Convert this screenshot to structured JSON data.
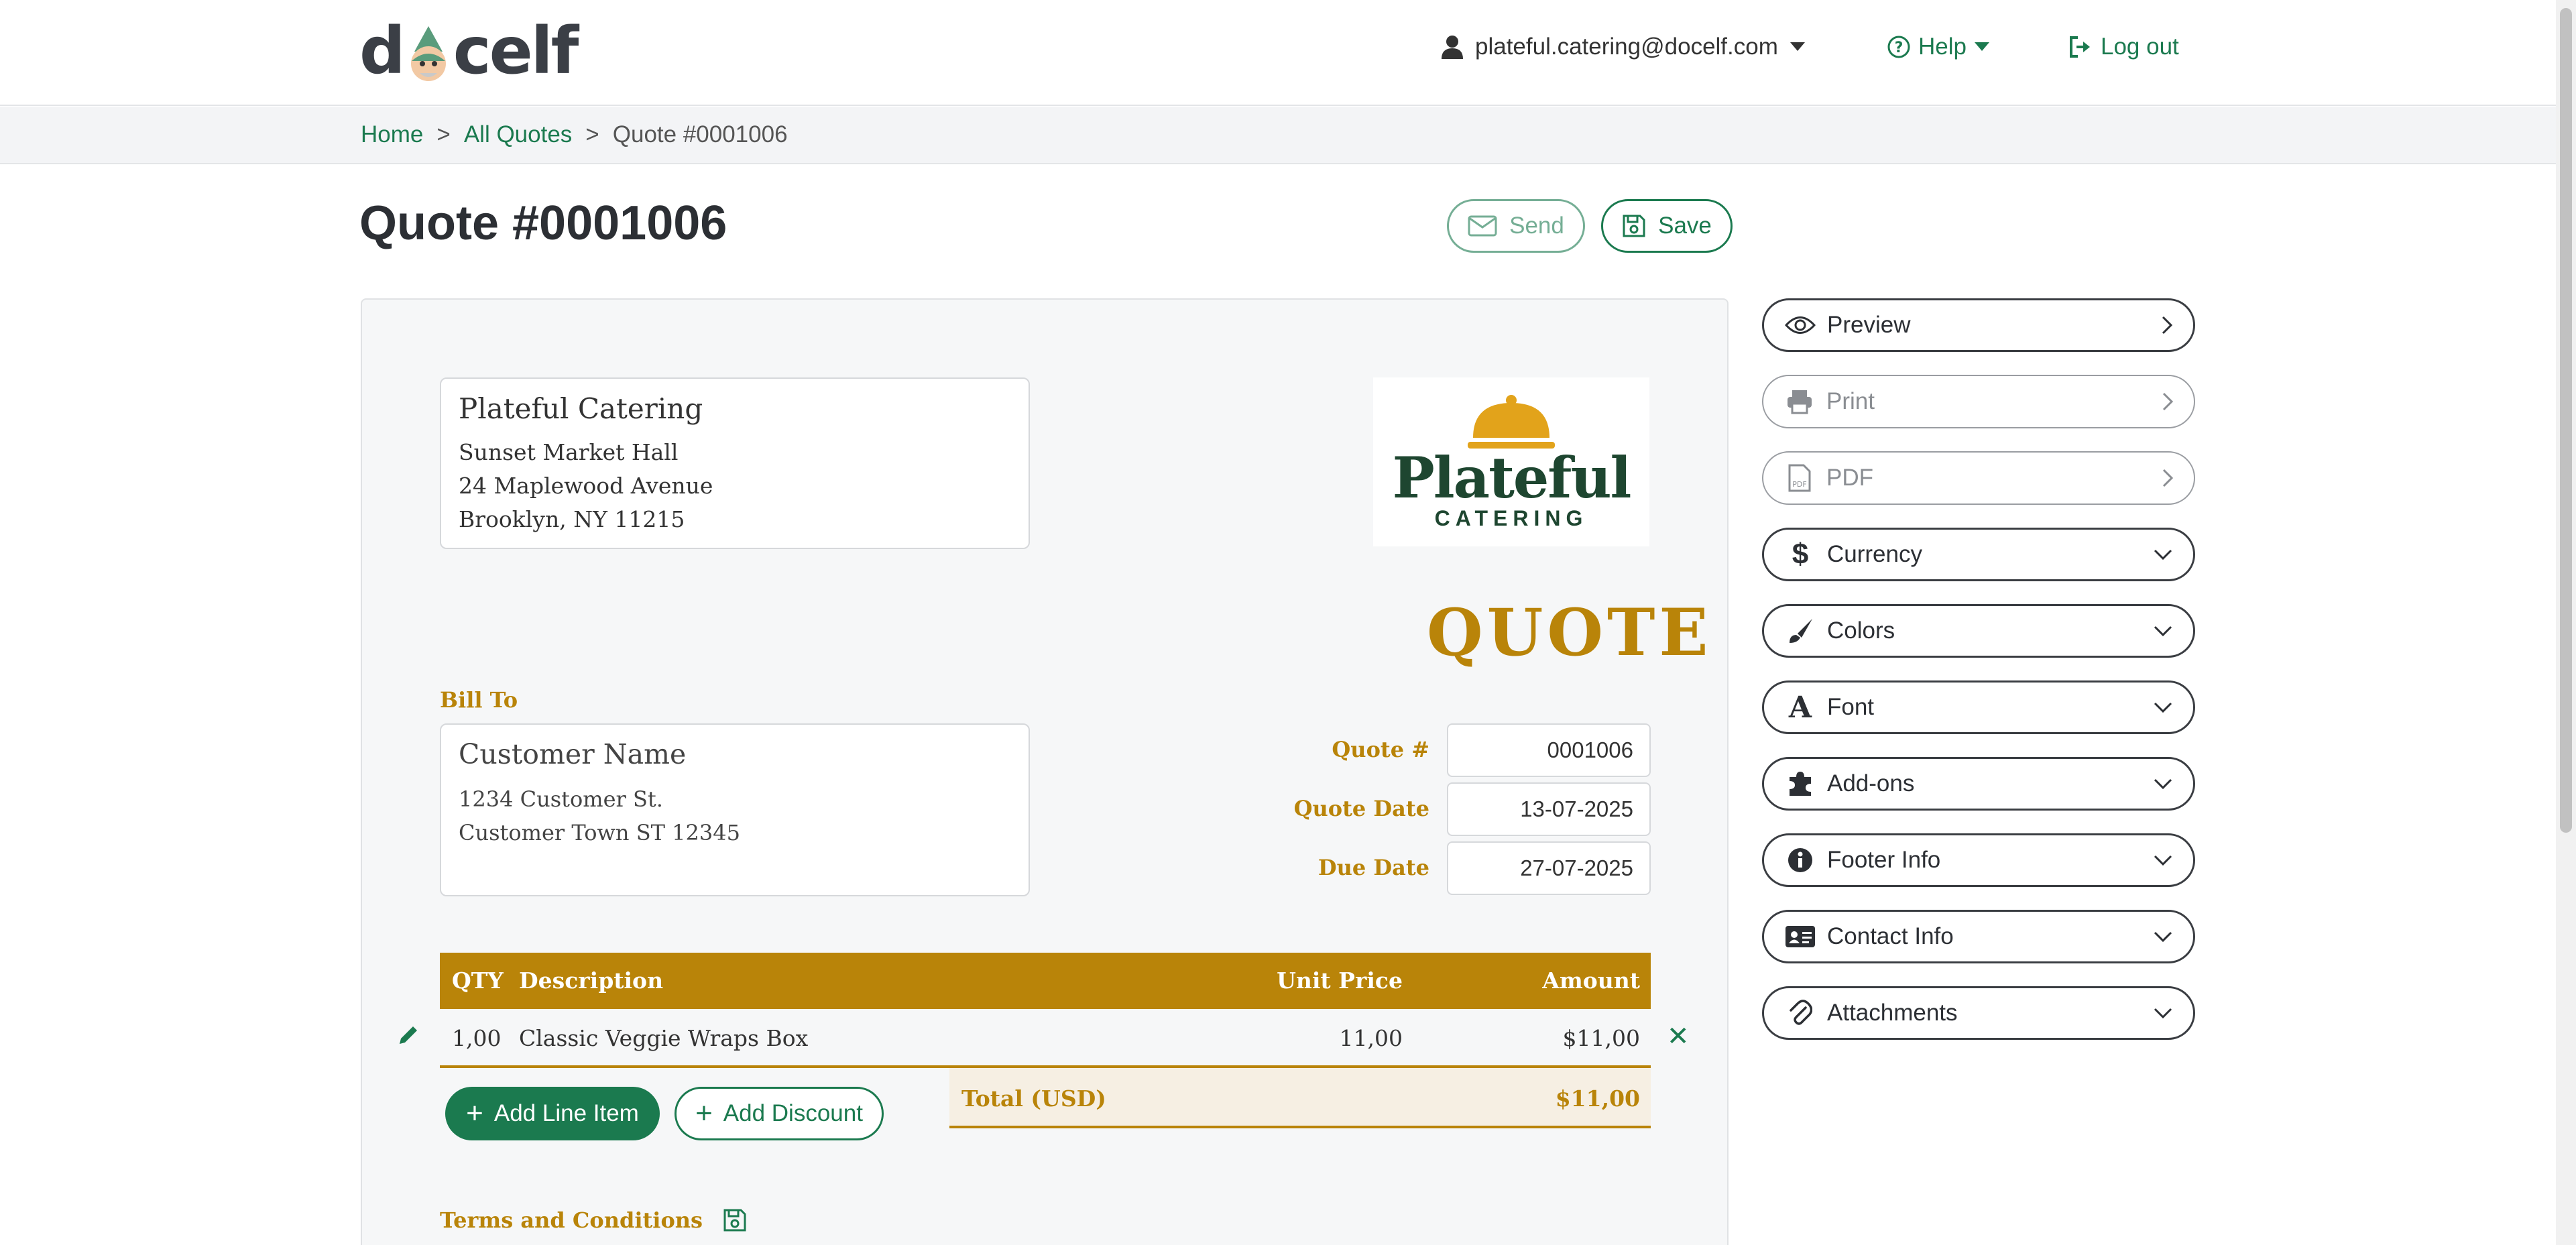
{
  "header": {
    "logo_text": "docelf",
    "user_email": "plateful.catering@docelf.com",
    "help_label": "Help",
    "logout_label": "Log out"
  },
  "breadcrumb": {
    "home": "Home",
    "all_quotes": "All Quotes",
    "current": "Quote #0001006"
  },
  "page": {
    "title": "Quote #0001006",
    "send_label": "Send",
    "save_label": "Save"
  },
  "document": {
    "sender": {
      "name": "Plateful Catering",
      "line1": "Sunset Market Hall",
      "line2": "24 Maplewood Avenue",
      "line3": "Brooklyn, NY 11215"
    },
    "brand_logo": {
      "word1": "Plateful",
      "word2": "CATERING"
    },
    "doc_type": "QUOTE",
    "bill_to_label": "Bill To",
    "bill_to": {
      "name": "Customer Name",
      "line1": "1234 Customer St.",
      "line2": "Customer Town ST 12345"
    },
    "meta": {
      "quote_no_label": "Quote #",
      "quote_no": "0001006",
      "quote_date_label": "Quote Date",
      "quote_date": "13-07-2025",
      "due_date_label": "Due Date",
      "due_date": "27-07-2025"
    },
    "table": {
      "headers": {
        "qty": "QTY",
        "description": "Description",
        "unit_price": "Unit Price",
        "amount": "Amount"
      },
      "rows": [
        {
          "qty": "1,00",
          "description": "Classic Veggie Wraps Box",
          "unit_price": "11,00",
          "amount": "$11,00"
        }
      ]
    },
    "add_line_item_label": "Add Line Item",
    "add_discount_label": "Add Discount",
    "total_label": "Total (USD)",
    "total_value": "$11,00",
    "terms_label": "Terms and Conditions"
  },
  "sidebar": {
    "items": [
      {
        "label": "Preview"
      },
      {
        "label": "Print"
      },
      {
        "label": "PDF"
      },
      {
        "label": "Currency"
      },
      {
        "label": "Colors"
      },
      {
        "label": "Font"
      },
      {
        "label": "Add-ons"
      },
      {
        "label": "Footer Info"
      },
      {
        "label": "Contact Info"
      },
      {
        "label": "Attachments"
      }
    ]
  },
  "colors": {
    "brand_green": "#1b7a4f",
    "accent_gold": "#b98409",
    "logo_green": "#1e4630"
  }
}
